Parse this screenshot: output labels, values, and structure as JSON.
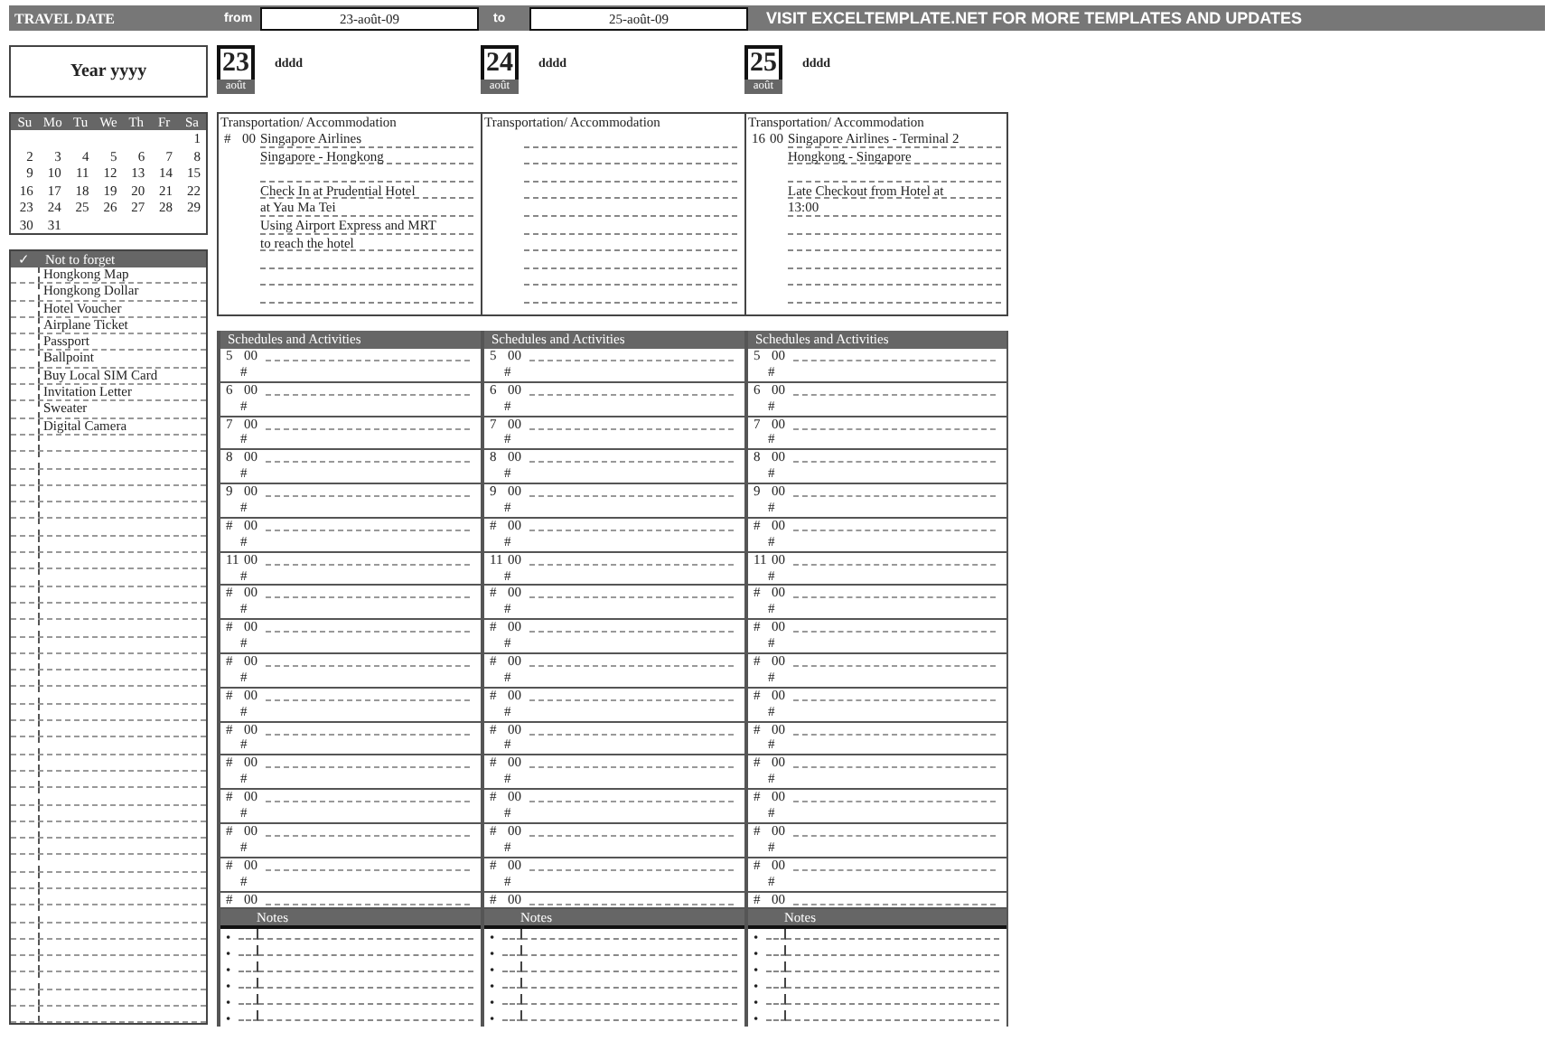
{
  "header": {
    "title": "TRAVEL DATE",
    "from_label": "from",
    "from_date": "23-août-09",
    "to_label": "to",
    "to_date": "25-août-09",
    "banner": "VISIT EXCELTEMPLATE.NET FOR MORE TEMPLATES AND UPDATES"
  },
  "year_box": "Year yyyy",
  "calendar": {
    "weekdays": [
      "Su",
      "Mo",
      "Tu",
      "We",
      "Th",
      "Fr",
      "Sa"
    ],
    "weeks": [
      [
        "1"
      ],
      [
        "2",
        "3",
        "4",
        "5",
        "6",
        "7",
        "8"
      ],
      [
        "9",
        "10",
        "11",
        "12",
        "13",
        "14",
        "15"
      ],
      [
        "16",
        "17",
        "18",
        "19",
        "20",
        "21",
        "22"
      ],
      [
        "23",
        "24",
        "25",
        "26",
        "27",
        "28",
        "29"
      ],
      [
        "30",
        "31"
      ]
    ]
  },
  "checklist": {
    "mark": "✓",
    "title": "Not to forget",
    "items": [
      "Hongkong Map",
      "Hongkong Dollar",
      "Hotel Voucher",
      "Airplane Ticket",
      "Passport",
      "Ballpoint",
      "Buy Local SIM Card",
      "Invitation Letter",
      "Sweater",
      "Digital Camera"
    ]
  },
  "days": [
    {
      "day": "23",
      "month": "août",
      "weekday": "dddd",
      "transport": {
        "title": "Transportation/ Accommodation",
        "hour": "#",
        "minute": "00",
        "blocks": [
          [
            "Singapore Airlines",
            "Singapore - Hongkong"
          ],
          [
            "Check In at Prudential Hotel",
            "at Yau Ma Tei",
            "Using Airport Express and MRT",
            "to reach the hotel"
          ]
        ]
      },
      "schedule_title": "Schedules and Activities",
      "slots": [
        {
          "hour": "5",
          "minute": "00",
          "sub": "#"
        },
        {
          "hour": "6",
          "minute": "00",
          "sub": "#"
        },
        {
          "hour": "7",
          "minute": "00",
          "sub": "#"
        },
        {
          "hour": "8",
          "minute": "00",
          "sub": "#"
        },
        {
          "hour": "9",
          "minute": "00",
          "sub": "#"
        },
        {
          "hour": "#",
          "minute": "00",
          "sub": "#"
        },
        {
          "hour": "11",
          "minute": "00",
          "sub": "#"
        },
        {
          "hour": "#",
          "minute": "00",
          "sub": "#"
        },
        {
          "hour": "#",
          "minute": "00",
          "sub": "#"
        },
        {
          "hour": "#",
          "minute": "00",
          "sub": "#"
        },
        {
          "hour": "#",
          "minute": "00",
          "sub": "#"
        },
        {
          "hour": "#",
          "minute": "00",
          "sub": "#"
        },
        {
          "hour": "#",
          "minute": "00",
          "sub": "#"
        },
        {
          "hour": "#",
          "minute": "00",
          "sub": "#"
        },
        {
          "hour": "#",
          "minute": "00",
          "sub": "#"
        },
        {
          "hour": "#",
          "minute": "00",
          "sub": "#"
        },
        {
          "hour": "#",
          "minute": "00"
        }
      ],
      "notes_title": "Notes",
      "note_bullets": [
        "•",
        "•",
        "•",
        "•",
        "•",
        "•"
      ]
    },
    {
      "day": "24",
      "month": "août",
      "weekday": "dddd",
      "transport": {
        "title": "Transportation/ Accommodation"
      },
      "schedule_title": "Schedules and Activities",
      "slots": [
        {
          "hour": "5",
          "minute": "00",
          "sub": "#"
        },
        {
          "hour": "6",
          "minute": "00",
          "sub": "#"
        },
        {
          "hour": "7",
          "minute": "00",
          "sub": "#"
        },
        {
          "hour": "8",
          "minute": "00",
          "sub": "#"
        },
        {
          "hour": "9",
          "minute": "00",
          "sub": "#"
        },
        {
          "hour": "#",
          "minute": "00",
          "sub": "#"
        },
        {
          "hour": "11",
          "minute": "00",
          "sub": "#"
        },
        {
          "hour": "#",
          "minute": "00",
          "sub": "#"
        },
        {
          "hour": "#",
          "minute": "00",
          "sub": "#"
        },
        {
          "hour": "#",
          "minute": "00",
          "sub": "#"
        },
        {
          "hour": "#",
          "minute": "00",
          "sub": "#"
        },
        {
          "hour": "#",
          "minute": "00",
          "sub": "#"
        },
        {
          "hour": "#",
          "minute": "00",
          "sub": "#"
        },
        {
          "hour": "#",
          "minute": "00",
          "sub": "#"
        },
        {
          "hour": "#",
          "minute": "00",
          "sub": "#"
        },
        {
          "hour": "#",
          "minute": "00",
          "sub": "#"
        },
        {
          "hour": "#",
          "minute": "00"
        }
      ],
      "notes_title": "Notes",
      "note_bullets": [
        "•",
        "•",
        "•",
        "•",
        "•",
        "•"
      ]
    },
    {
      "day": "25",
      "month": "août",
      "weekday": "dddd",
      "transport": {
        "title": "Transportation/ Accommodation",
        "hour": "16",
        "minute": "00",
        "blocks": [
          [
            "Singapore Airlines - Terminal 2",
            "Hongkong - Singapore"
          ],
          [
            "Late Checkout from Hotel at",
            "13:00"
          ]
        ]
      },
      "schedule_title": "Schedules and Activities",
      "slots": [
        {
          "hour": "5",
          "minute": "00",
          "sub": "#"
        },
        {
          "hour": "6",
          "minute": "00",
          "sub": "#"
        },
        {
          "hour": "7",
          "minute": "00",
          "sub": "#"
        },
        {
          "hour": "8",
          "minute": "00",
          "sub": "#"
        },
        {
          "hour": "9",
          "minute": "00",
          "sub": "#"
        },
        {
          "hour": "#",
          "minute": "00",
          "sub": "#"
        },
        {
          "hour": "11",
          "minute": "00",
          "sub": "#"
        },
        {
          "hour": "#",
          "minute": "00",
          "sub": "#"
        },
        {
          "hour": "#",
          "minute": "00",
          "sub": "#"
        },
        {
          "hour": "#",
          "minute": "00",
          "sub": "#"
        },
        {
          "hour": "#",
          "minute": "00",
          "sub": "#"
        },
        {
          "hour": "#",
          "minute": "00",
          "sub": "#"
        },
        {
          "hour": "#",
          "minute": "00",
          "sub": "#"
        },
        {
          "hour": "#",
          "minute": "00",
          "sub": "#"
        },
        {
          "hour": "#",
          "minute": "00",
          "sub": "#"
        },
        {
          "hour": "#",
          "minute": "00",
          "sub": "#"
        },
        {
          "hour": "#",
          "minute": "00"
        }
      ],
      "notes_title": "Notes",
      "note_bullets": [
        "•",
        "•",
        "•",
        "•",
        "•",
        "•"
      ]
    }
  ]
}
